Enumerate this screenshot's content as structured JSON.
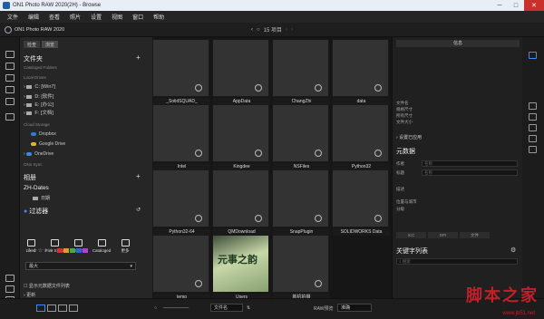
{
  "window": {
    "title": "ON1 Photo RAW 2020(2H) - Browse"
  },
  "menu": [
    "文件",
    "编辑",
    "查看",
    "照片",
    "设置",
    "视图",
    "窗口",
    "帮助"
  ],
  "app": {
    "brand": "ON1 Photo RAW 2020",
    "nav_label": "15 项目"
  },
  "left": {
    "tabs": [
      "检查",
      "浏览"
    ],
    "folders_title": "文件夹",
    "cataloged_label": "Cataloged Folders",
    "local_label": "Local Drives",
    "drives": [
      "C: [Win7]",
      "D: [软件]",
      "E: [办公]",
      "F: [文档]"
    ],
    "cloud_label": "Cloud Storage",
    "clouds": [
      "Dropbox",
      "Google Drive",
      "OneDrive"
    ],
    "one_sync": "ON1 Sync",
    "albums_title": "相册",
    "zh_dates": "ZH-Dates",
    "zh_sub": "日期",
    "filter_title": "过滤器",
    "filters": [
      "Liked",
      "Five Stars",
      "Recent",
      "Cataloged",
      "更多"
    ],
    "sort": "最大",
    "show_hidden": "显示元数据文件列表",
    "bottom_item": "更新"
  },
  "grid": {
    "items": [
      "_SolidSQUAD_",
      "AppData",
      "ChangZhi",
      "data",
      "Intel",
      "Kingdee",
      "NSFiles",
      "Python32",
      "Python32-64",
      "QMDownload",
      "SnapPlugin",
      "SOLIDWORKS Data",
      "temp",
      "Users",
      "新机拍摄"
    ],
    "users_thumb_text": "元事之韵"
  },
  "right": {
    "top_tab": "信息",
    "info_fields": [
      "文件名",
      "规格尺寸",
      "所有尺寸",
      "文件大小"
    ],
    "settings_applied": "设置已应用",
    "metadata_title": "元数据",
    "meta_labels": [
      "作者",
      "标题",
      "描述",
      "位置与城市",
      "分级"
    ],
    "meta_placeholders": [
      "名称",
      "名称",
      "",
      "",
      ""
    ],
    "btns": [
      "ICC",
      "DPI",
      "文件"
    ],
    "keyword_title": "关键字列表",
    "search_placeholder": "搜索"
  },
  "bottom": {
    "sort_label": "文件名",
    "raw_label": "RAW预览",
    "raw_value": "准确"
  },
  "watermark": {
    "main": "脚本之家",
    "sub": "www.jb51.net"
  }
}
